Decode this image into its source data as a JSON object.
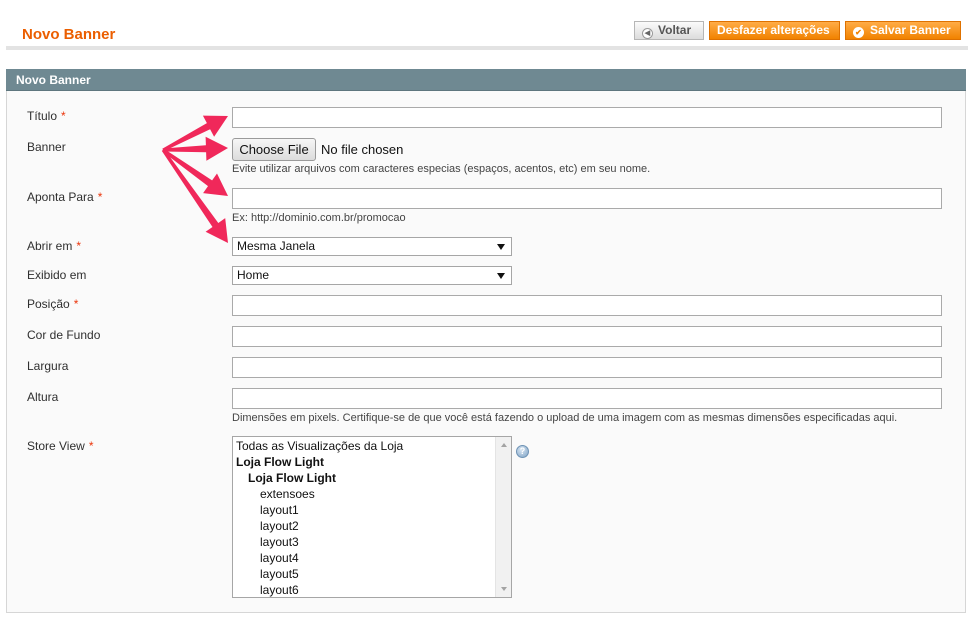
{
  "header": {
    "title": "Novo Banner",
    "back_label": "Voltar",
    "reset_label": "Desfazer alterações",
    "save_label": "Salvar Banner"
  },
  "form": {
    "section_title": "Novo Banner",
    "required_mark": "*",
    "fields": {
      "titulo": {
        "label": "Título",
        "value": ""
      },
      "banner": {
        "label": "Banner",
        "button_label": "Choose File",
        "status": "No file chosen",
        "note": "Evite utilizar arquivos com caracteres especias (espaços, acentos, etc) em seu nome."
      },
      "aponta_para": {
        "label": "Aponta Para",
        "value": "",
        "note": "Ex: http://dominio.com.br/promocao"
      },
      "abrir_em": {
        "label": "Abrir em",
        "selected": "Mesma Janela"
      },
      "exibido_em": {
        "label": "Exibido em",
        "selected": "Home"
      },
      "posicao": {
        "label": "Posição",
        "value": ""
      },
      "cor_de_fundo": {
        "label": "Cor de Fundo",
        "value": ""
      },
      "largura": {
        "label": "Largura",
        "value": ""
      },
      "altura": {
        "label": "Altura",
        "value": "",
        "note": "Dimensões em pixels. Certifique-se de que você está fazendo o upload de uma imagem com as mesmas dimensões especificadas aqui."
      },
      "store_view": {
        "label": "Store View",
        "options": [
          {
            "text": "Todas as Visualizações da Loja",
            "level": 0
          },
          {
            "text": "Loja Flow Light",
            "level": 1
          },
          {
            "text": "Loja Flow Light",
            "level": 2
          },
          {
            "text": "extensoes",
            "level": 3
          },
          {
            "text": "layout1",
            "level": 3
          },
          {
            "text": "layout2",
            "level": 3
          },
          {
            "text": "layout3",
            "level": 3
          },
          {
            "text": "layout4",
            "level": 3
          },
          {
            "text": "layout5",
            "level": 3
          },
          {
            "text": "layout6",
            "level": 3
          }
        ]
      }
    }
  },
  "icons": {
    "back": "circle-left-arrow-icon",
    "save": "check-circle-icon",
    "help": "question-help-icon"
  },
  "colors": {
    "title_orange": "#eb5e00",
    "button_orange": "#f18200",
    "section_header": "#6f8992",
    "required": "#eb340a",
    "annotation_arrow": "#f0285a"
  }
}
